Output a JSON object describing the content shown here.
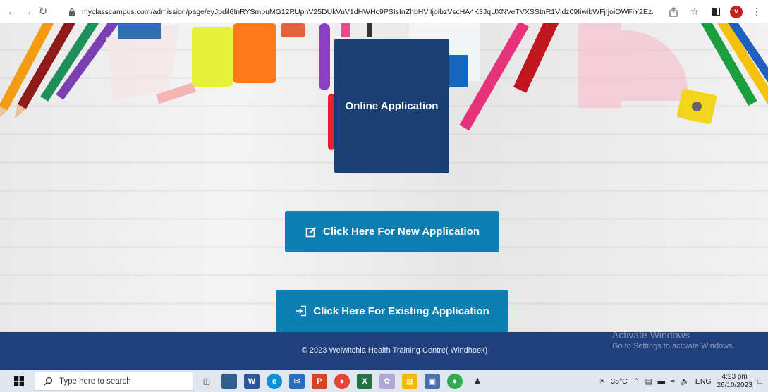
{
  "browser": {
    "url": "myclasscampus.com/admission/page/eyJpdil6InRYSmpuMG12RUpnV25DUkVuV1dHWHc9PSIsInZhbHVlIjoibzVscHA4K3JqUXNVeTVXSStnR1Vldz09IiwibWFjIjoiOWFiY2Ez...",
    "profile_initial": "v"
  },
  "hero": {
    "title": "Online Application"
  },
  "actions": {
    "new_application": "Click Here For New Application",
    "existing_application": "Click Here For Existing Application"
  },
  "footer": {
    "copyright": "© 2023 Welwitchia Health Training Centre( Windhoek)",
    "watermark_title": "Activate Windows",
    "watermark_sub": "Go to Settings to activate Windows."
  },
  "taskbar": {
    "search_placeholder": "Type here to search",
    "temperature": "35°C",
    "language": "ENG",
    "time": "4:23 pm",
    "date": "26/10/2023"
  },
  "colors": {
    "hero_bg": "#1a3f73",
    "cta_bg": "#0d7fb3",
    "footer_bg": "#213f7c"
  }
}
